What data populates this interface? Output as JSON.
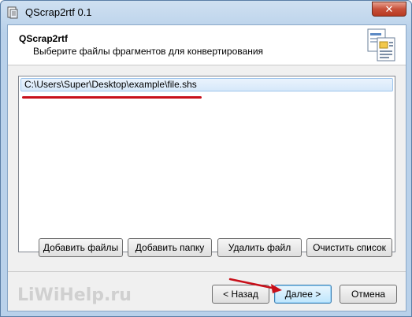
{
  "window": {
    "title": "QScrap2rtf 0.1",
    "close_symbol": "✕"
  },
  "header": {
    "title": "QScrap2rtf",
    "subtitle": "Выберите файлы фрагментов для конвертирования"
  },
  "file_list": {
    "items": [
      {
        "path": "C:\\Users\\Super\\Desktop\\example\\file.shs",
        "selected": true
      }
    ]
  },
  "actions": {
    "add_files": "Добавить файлы",
    "add_folder": "Добавить папку",
    "remove_file": "Удалить файл",
    "clear_list": "Очистить список"
  },
  "navigation": {
    "back": "< Назад",
    "next": "Далее >",
    "cancel": "Отмена"
  },
  "watermark": "LiWiHelp.ru",
  "colors": {
    "annotation_red": "#c8101a",
    "selection": "#d6e8fa"
  }
}
